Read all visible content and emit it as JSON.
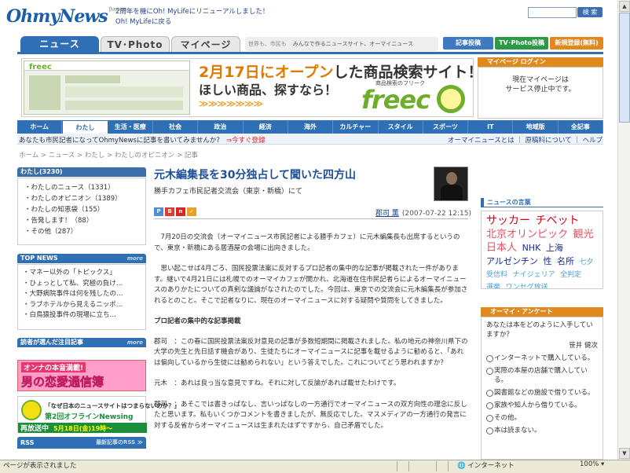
{
  "header": {
    "logo": "OhmyNews",
    "logo_version": "βversion",
    "announce_1": "2周年を機にOh! MyLifeにリニューアルしました！",
    "announce_2": "Oh! MyLifeに戻る",
    "search_button": "検 索"
  },
  "tabs": {
    "news": "ニュース",
    "tvphoto": "TV･Photo",
    "mypage": "マイページ"
  },
  "slogan": {
    "grey": "世界も、市民も",
    "text": "みんなで作るニュースサイト、オーマイニュース"
  },
  "header_buttons": {
    "post": "記事投稿",
    "tvpost": "TV･Photo投稿",
    "register": "新規登録(無料)"
  },
  "banner": {
    "headline_date": "2月17日に",
    "headline_open": "オープン",
    "headline_rest": "した商品検索サイト！",
    "subline": "ほしい商品、探すなら！",
    "arrows": "≫≫≫≫≫≫≫",
    "brand_sub": "商品検索のフリーク",
    "brand": "freec",
    "shot_logo": "freec"
  },
  "mypage_login": {
    "title": "マイページ ログイン",
    "line1": "現在マイページは",
    "line2": "サービス停止中です。"
  },
  "categories": [
    "ホーム",
    "わたし",
    "生活・医療",
    "社会",
    "政治",
    "経済",
    "海外",
    "カルチャー",
    "スタイル",
    "スポーツ",
    "IT",
    "地域版",
    "全記事"
  ],
  "subnav": {
    "prompt": "あなたも市民記者になってOhmyNewsに記事を書いてみませんか？",
    "register_link": "⇒今すぐ登録",
    "right": "オーマイニュースとは ｜ 原稿料について ｜ ヘルプ"
  },
  "breadcrumb": "ホーム > ニュース > わたし > わたしのオピニオン > 記事",
  "left_menu": {
    "title": "わたし",
    "count": "(3230)",
    "items": [
      "・わたしのニュース（1331）",
      "・わたしのオピニオン（1389）",
      "・わたしの知恵袋（155）",
      "・告発します！（88）",
      "・その他（287）"
    ]
  },
  "top_news": {
    "title": "TOP NEWS",
    "more": "more",
    "items": [
      "・マネー以外の「トピックス」",
      "・ひょっとして私、究極の負け…",
      "・大野病院事件は何を残したの…",
      "・ラブホテルから見えるニッポ…",
      "・白鳥猿投事件の現場に立ち…"
    ]
  },
  "hot_pick": {
    "title": "読者が選んだ注目記事",
    "more": "more"
  },
  "ads": {
    "ad1_top": "オンナの本音満載!",
    "ad1_main": "男の恋愛通信簿",
    "ad2_line1": "「なぜ日本のニュースサイトはつまらないのか？」",
    "ad2_line2": "第2回オフラインNewsing",
    "ad2_rerun": "再放送中",
    "ad2_date": "5月18日(金)19時～"
  },
  "rss": {
    "title": "RSS",
    "more": "最新記事のRSS ≫"
  },
  "article": {
    "title": "元木編集長を30分独占して聞いた四方山",
    "subtitle": "勝手カフェ市民記者交流会（東京・新橋）にて",
    "author": "郡司 薫",
    "date": "(2007-07-22 12:15)",
    "p1": "7月20日の交流会（オーマイニュース市民記者による勝手カフェ）に元木編集長も出席するというので、東京・新橋にある居酒屋の会場に出向きました。",
    "p2": "思い起こせば4月ごろ、国民投票法案に反対するプロ記者の集中的な記事が掲載されたー件があります。継いで4月21日には札幌でのオーマイカフェが開かれ、北海道在住市民記者らによるオーマイニュースのありかたについての真剣な議論がなされたのでした。今回は、東京での交流会に元木編集長が参加されるとのこと。そこで記者なりに、現在のオーマイニュースに対する疑問や質問をしてきました。",
    "h1": "プロ記者の集中的な記事掲載",
    "p3": "郡司　：この春に国民投票法案反対意見の記事が多数短期間に掲載されました。私の地元の神奈川県下の大学の先生と先日話す機会があり、生徒たちにオーマイニュースに記事を載せるように勧めると、「あれは偏向しているから生徒には勧められない」という答えでした。これについてどう思われますか？",
    "p4": "元木　：あれは良っ当な意見ですね。それに対して反論があれば載せたわけです。",
    "p5": "郡司　：あそこでは書きっぱなし、言いっぱなしの一方通行でオーマイニュースの双方向性の理念に反したと思います。私もいくつかコメントを書きましたが、無反応でした。マスメディアの一方通行の発言に対する反省からオーマイニュースは生まれたはずですから、自己矛盾でした。"
  },
  "keywords": {
    "title": "ニュースの言葉",
    "words": [
      {
        "text": "サッカー",
        "color": "#d8001c",
        "size": "14px"
      },
      {
        "text": "チベット",
        "color": "#d8001c",
        "size": "14px"
      },
      {
        "text": "北京オリンピック",
        "color": "#e05060",
        "size": "13px"
      },
      {
        "text": "観光",
        "color": "#e05060",
        "size": "13px"
      },
      {
        "text": "日本人",
        "color": "#e05060",
        "size": "13px"
      },
      {
        "text": "NHK",
        "color": "#1a2a90",
        "size": "11px"
      },
      {
        "text": "上海",
        "color": "#1a2a90",
        "size": "11px"
      },
      {
        "text": "アルゼンチン",
        "color": "#1a2a90",
        "size": "11px"
      },
      {
        "text": "性",
        "color": "#1a2a90",
        "size": "11px"
      },
      {
        "text": "名所",
        "color": "#1a2a90",
        "size": "11px"
      },
      {
        "text": "七夕",
        "color": "#4aa0d8",
        "size": "9px"
      },
      {
        "text": "受信料",
        "color": "#4aa0d8",
        "size": "9px"
      },
      {
        "text": "ナイジェリア",
        "color": "#4aa0d8",
        "size": "9px"
      },
      {
        "text": "全判定",
        "color": "#4aa0d8",
        "size": "9px"
      },
      {
        "text": "選挙",
        "color": "#4aa0d8",
        "size": "9px"
      },
      {
        "text": "ワンセグ放送",
        "color": "#4aa0d8",
        "size": "9px"
      }
    ]
  },
  "enquete": {
    "title": "オーマイ・アンケート",
    "question": "あなたは本をどのように入手していますか？",
    "by": "笹井 健次",
    "options": [
      "インターネットで購入している。",
      "実際の本屋の店舗で購入している。",
      "図書館などの施設で借りている。",
      "家族や知人から借りている。",
      "その他。",
      "本は読まない。"
    ]
  },
  "statusbar": {
    "text": "ページが表示されました",
    "zone": "インターネット",
    "zoom": "100%"
  },
  "colors": {
    "brand_blue": "#2f6fb5",
    "accent_orange": "#e08a1e",
    "green": "#6fae2c"
  }
}
